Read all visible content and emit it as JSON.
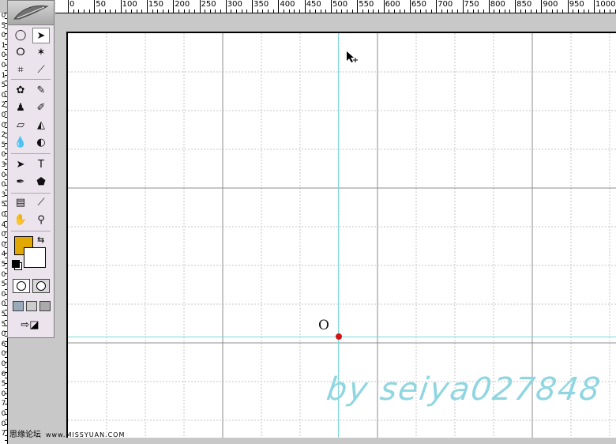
{
  "ruler": {
    "top_labels": [
      "0",
      "50",
      "100",
      "150",
      "200",
      "250",
      "300",
      "350",
      "400",
      "450",
      "500",
      "550",
      "600",
      "650",
      "700",
      "750",
      "800",
      "850",
      "900",
      "950",
      "1000"
    ],
    "left_digits": [
      "0",
      "5",
      "0",
      "1",
      "0",
      "0",
      "1",
      "5",
      "0",
      "2",
      "0",
      "0",
      "2",
      "5",
      "0",
      "3",
      "0",
      "0",
      "3",
      "5",
      "0",
      "4",
      "0",
      "0",
      "4",
      "5",
      "0",
      "5",
      "0",
      "0",
      "5",
      "5",
      "0",
      "6",
      "0",
      "0",
      "6",
      "5",
      "0",
      "7",
      "0",
      "0",
      "7"
    ]
  },
  "toolbox": {
    "tools": [
      {
        "name": "elliptical-marquee-icon",
        "glyph": "◯"
      },
      {
        "name": "move-icon",
        "glyph": "➤"
      },
      {
        "name": "lasso-icon",
        "glyph": "ⵔ"
      },
      {
        "name": "magic-wand-icon",
        "glyph": "✶"
      },
      {
        "name": "crop-icon",
        "glyph": "⌗"
      },
      {
        "name": "slice-icon",
        "glyph": "⟋"
      },
      {
        "name": "healing-brush-icon",
        "glyph": "✿"
      },
      {
        "name": "brush-icon",
        "glyph": "✎"
      },
      {
        "name": "clone-stamp-icon",
        "glyph": "♟"
      },
      {
        "name": "history-brush-icon",
        "glyph": "✐"
      },
      {
        "name": "eraser-icon",
        "glyph": "▱"
      },
      {
        "name": "paint-bucket-icon",
        "glyph": "◭"
      },
      {
        "name": "blur-icon",
        "glyph": "💧"
      },
      {
        "name": "dodge-icon",
        "glyph": "◐"
      },
      {
        "name": "path-selection-icon",
        "glyph": "➤"
      },
      {
        "name": "type-icon",
        "glyph": "T"
      },
      {
        "name": "pen-icon",
        "glyph": "✒"
      },
      {
        "name": "shape-icon",
        "glyph": "⬟"
      },
      {
        "name": "notes-icon",
        "glyph": "▤"
      },
      {
        "name": "eyedropper-icon",
        "glyph": "⟋"
      },
      {
        "name": "hand-icon",
        "glyph": "✋"
      },
      {
        "name": "zoom-icon",
        "glyph": "⚲"
      }
    ],
    "foreground_color": "#e0a800",
    "background_color": "#ffffff"
  },
  "canvas": {
    "origin_label": "O",
    "guide_color": "#7fd7dc",
    "origin_color": "#d41414"
  },
  "watermark": "by seiya027848",
  "footer": {
    "site_name": "思缘论坛",
    "url": "www.MISSYUAN.COM"
  }
}
